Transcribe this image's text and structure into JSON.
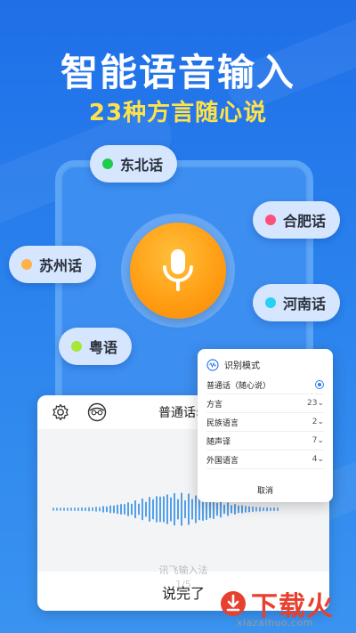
{
  "header": {
    "title": "智能语音输入",
    "subtitle": "23种方言随心说"
  },
  "dialects": [
    {
      "label": "东北话",
      "color": "#1fcc4a"
    },
    {
      "label": "合肥话",
      "color": "#ff4f7a"
    },
    {
      "label": "苏州话",
      "color": "#ffb24a"
    },
    {
      "label": "河南话",
      "color": "#27d0f5"
    },
    {
      "label": "粤语",
      "color": "#a8e63a"
    }
  ],
  "input_panel": {
    "language_selector": "普通话",
    "brand_text": "讯飞输入法",
    "page_indicator": "1/5",
    "done_button": "说完了"
  },
  "mode_popup": {
    "title": "识别模式",
    "rows": [
      {
        "label": "普通话（随心说）",
        "value": ""
      },
      {
        "label": "方言",
        "value": "23"
      },
      {
        "label": "民族语言",
        "value": "2"
      },
      {
        "label": "随声译",
        "value": "7"
      },
      {
        "label": "外国语言",
        "value": "4"
      }
    ],
    "cancel": "取消"
  },
  "watermark": {
    "text": "下载火",
    "url": "xiazaihuo.com"
  }
}
